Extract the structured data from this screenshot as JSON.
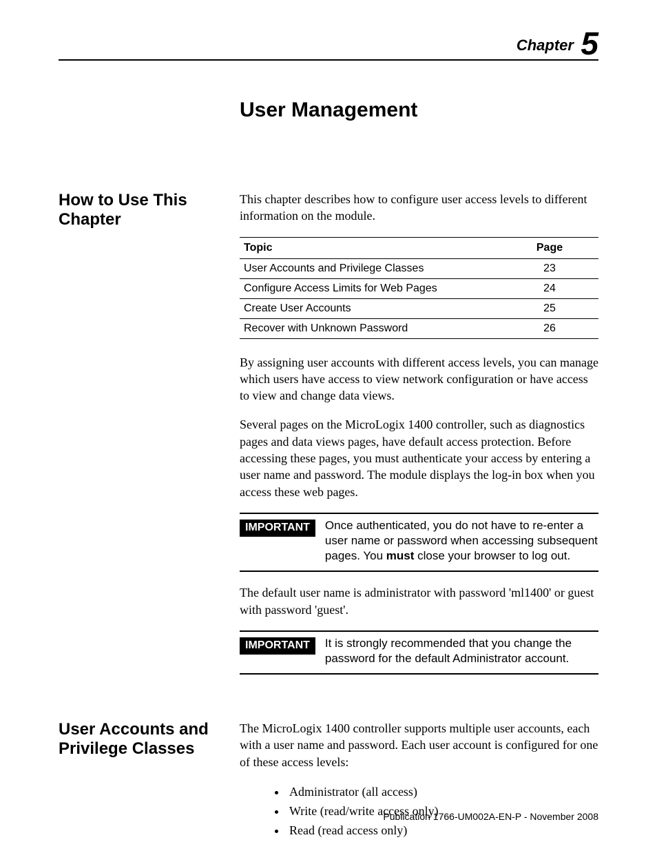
{
  "chapter": {
    "label": "Chapter",
    "number": "5"
  },
  "title": "User Management",
  "section1": {
    "heading": "How to Use This Chapter",
    "intro": "This chapter describes how to configure user access levels to different information on the module.",
    "table": {
      "head_topic": "Topic",
      "head_page": "Page",
      "rows": [
        {
          "t": "User Accounts and Privilege Classes",
          "p": "23"
        },
        {
          "t": "Configure Access Limits for Web Pages",
          "p": "24"
        },
        {
          "t": "Create User Accounts",
          "p": "25"
        },
        {
          "t": "Recover with Unknown Password",
          "p": "26"
        }
      ]
    },
    "para2": "By assigning user accounts with different access levels, you can manage which users have access to view network configuration or have access to view and change data views.",
    "para3": "Several pages on the MicroLogix 1400 controller, such as diagnostics pages and data views pages, have default access protection. Before accessing these pages, you must authenticate your access by entering a user name and password. The module displays the log-in box when you access these web pages.",
    "important1": {
      "label": "IMPORTANT",
      "text_a": "Once authenticated, you do not have to re-enter a user name or password when accessing subsequent pages. You ",
      "text_bold": "must",
      "text_b": " close your browser to log out."
    },
    "para4": "The default user name is administrator with password 'ml1400' or guest with password 'guest'.",
    "important2": {
      "label": "IMPORTANT",
      "text": "It is strongly recommended that you change the password for the default Administrator account."
    }
  },
  "section2": {
    "heading": "User Accounts and Privilege Classes",
    "intro": "The MicroLogix 1400 controller supports multiple user accounts, each with a user name and password. Each user account is configured for one of these access levels:",
    "bullets": [
      "Administrator (all access)",
      "Write (read/write access only)",
      "Read (read access only)"
    ]
  },
  "footer": "Publication 1766-UM002A-EN-P - November 2008"
}
